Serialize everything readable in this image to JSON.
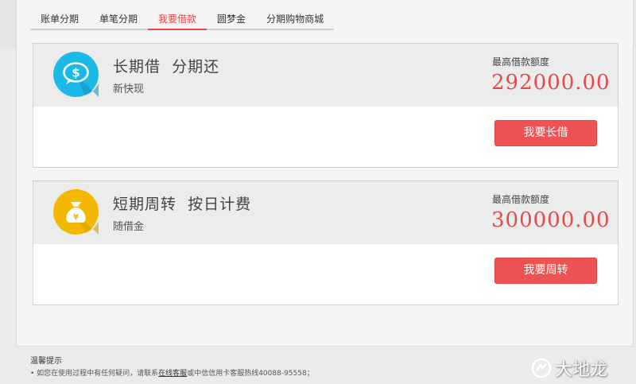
{
  "tabs": [
    {
      "label": "账单分期",
      "active": false
    },
    {
      "label": "单笔分期",
      "active": false
    },
    {
      "label": "我要借款",
      "active": true
    },
    {
      "label": "圆梦金",
      "active": false
    },
    {
      "label": "分期购物商城",
      "active": false
    }
  ],
  "cards": [
    {
      "icon": "speech-bubble-dollar-icon",
      "icon_color": "#1bb9e8",
      "title": "长期借  分期还",
      "subtitle": "新快现",
      "limit_label": "最高借款额度",
      "limit_value": "292000.00",
      "button_label": "我要长借"
    },
    {
      "icon": "money-bag-icon",
      "icon_color": "#f5b800",
      "title": "短期周转  按日计费",
      "subtitle": "随借金",
      "limit_label": "最高借款额度",
      "limit_value": "300000.00",
      "button_label": "我要周转"
    }
  ],
  "tips": {
    "title": "温馨提示",
    "line_prefix": "• 如您在使用过程中有任何疑问，请联系",
    "link": "在线客服",
    "line_suffix": "或中信信用卡客服热线40088-95558；"
  },
  "watermark": "大地龙",
  "colors": {
    "accent": "#e34a4a",
    "button": "#ee5353"
  }
}
